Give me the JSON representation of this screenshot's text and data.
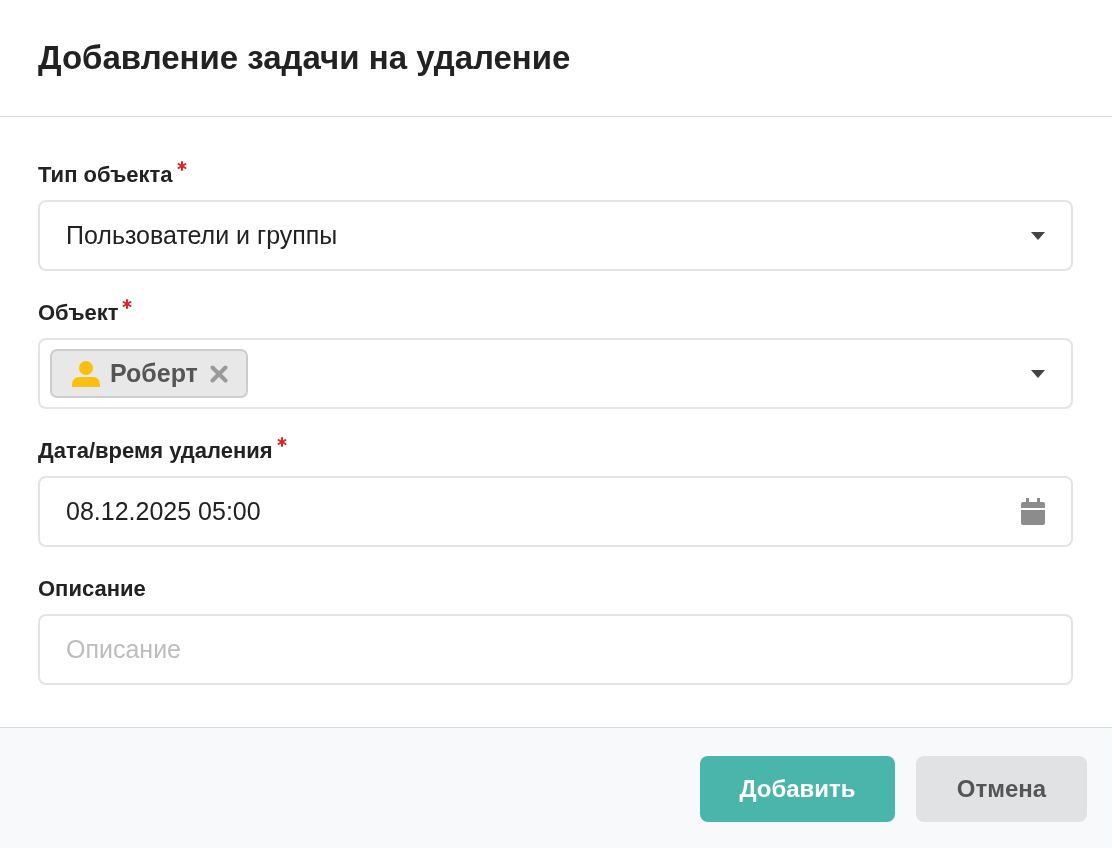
{
  "dialog": {
    "title": "Добавление задачи на удаление"
  },
  "fields": [
    {
      "kind": "select",
      "label": "Тип объекта",
      "required": true,
      "value": "Пользователи и группы"
    },
    {
      "kind": "multiselect",
      "label": "Объект",
      "required": true,
      "tags": [
        {
          "label": "Роберт"
        }
      ]
    },
    {
      "kind": "date",
      "label": "Дата/время удаления",
      "required": true,
      "value": "08.12.2025 05:00"
    },
    {
      "kind": "text",
      "label": "Описание",
      "required": false,
      "placeholder": "Описание"
    }
  ],
  "buttons": [
    {
      "kind": "primary",
      "label": "Добавить"
    },
    {
      "kind": "secondary",
      "label": "Отмена"
    }
  ]
}
